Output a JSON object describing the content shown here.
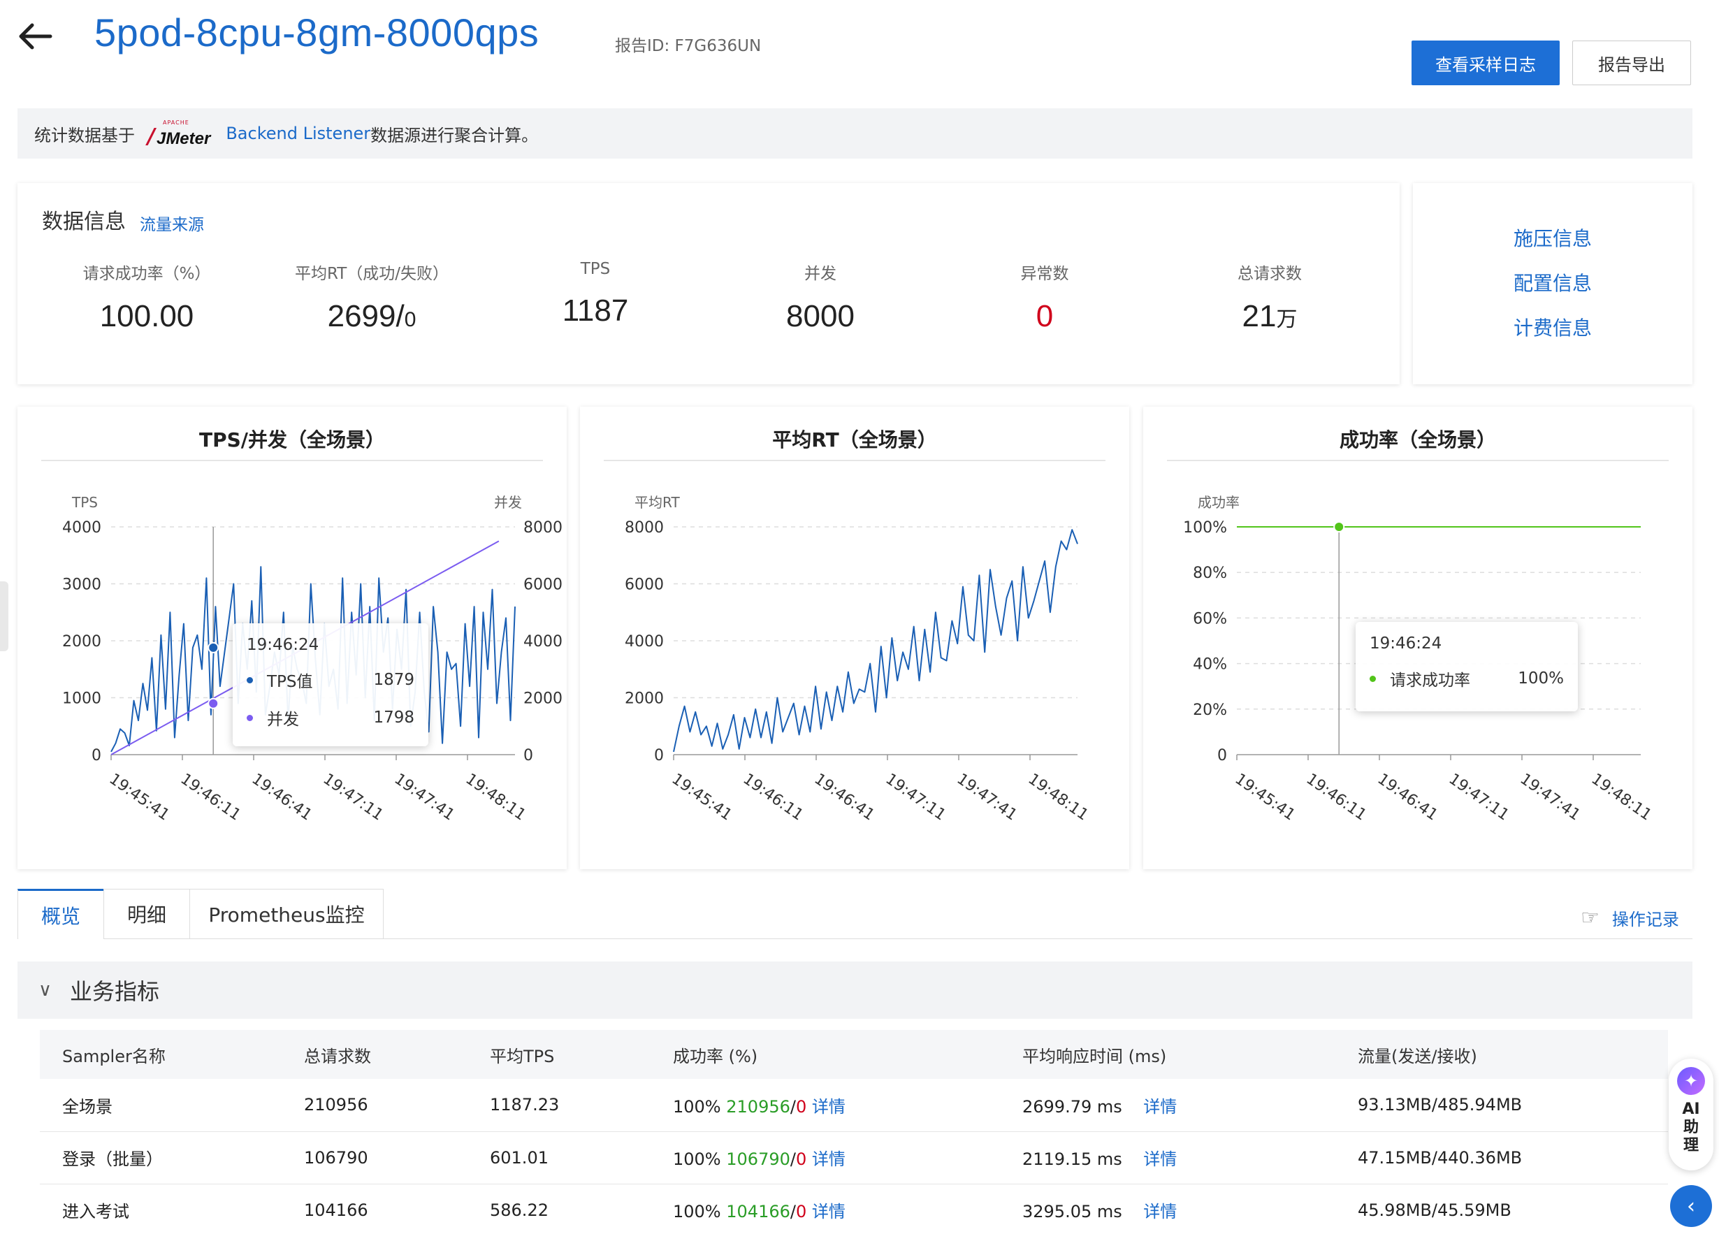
{
  "header": {
    "title": "5pod-8cpu-8gm-8000qps",
    "report_id": "报告ID:  F7G636UN",
    "view_log_label": "查看采样日志",
    "export_label": "报告导出"
  },
  "notice": {
    "prefix": "统计数据基于",
    "logo_text": "JMeter",
    "logo_small": "APACHE",
    "link": "Backend Listener",
    "suffix": "数据源进行聚合计算。"
  },
  "data_info": {
    "title": "数据信息",
    "source_link": "流量来源",
    "metrics": [
      {
        "label": "请求成功率（%）",
        "value": "100.00",
        "unit": ""
      },
      {
        "label": "平均RT（成功/失败）",
        "value": "2699/",
        "unit": "0"
      },
      {
        "label": "TPS",
        "value": "1187",
        "unit": ""
      },
      {
        "label": "并发",
        "value": "8000",
        "unit": ""
      },
      {
        "label": "异常数",
        "value": "0",
        "unit": ""
      },
      {
        "label": "总请求数",
        "value": "21",
        "unit": "万"
      }
    ]
  },
  "side_links": [
    "施压信息",
    "配置信息",
    "计费信息"
  ],
  "charts": {
    "x_ticks": [
      "19:45:41",
      "19:46:11",
      "19:46:41",
      "19:47:11",
      "19:47:41",
      "19:48:11"
    ],
    "tps": {
      "title": "TPS/并发（全场景）",
      "left_axis_name": "TPS",
      "right_axis_name": "并发",
      "left_ticks": [
        "0",
        "1000",
        "2000",
        "3000",
        "4000"
      ],
      "right_ticks": [
        "0",
        "2000",
        "4000",
        "6000",
        "8000"
      ],
      "tooltip": {
        "time": "19:46:24",
        "rows": [
          {
            "name": "TPS值",
            "value": "1879"
          },
          {
            "name": "并发",
            "value": "1798"
          }
        ]
      }
    },
    "rt": {
      "title": "平均RT（全场景）",
      "axis_name": "平均RT",
      "ticks": [
        "0",
        "2000",
        "4000",
        "6000",
        "8000"
      ]
    },
    "success": {
      "title": "成功率（全场景）",
      "axis_name": "成功率",
      "ticks": [
        "0",
        "20%",
        "40%",
        "60%",
        "80%",
        "100%"
      ],
      "tooltip": {
        "time": "19:46:24",
        "rows": [
          {
            "name": "请求成功率",
            "value": "100%"
          }
        ]
      }
    }
  },
  "chart_data": [
    {
      "type": "line",
      "title": "TPS/并发（全场景）",
      "x_range": [
        "19:45:41",
        "19:48:31"
      ],
      "series": [
        {
          "name": "TPS值",
          "axis": "left",
          "ylim": [
            0,
            4000
          ],
          "values": [
            50,
            200,
            450,
            380,
            160,
            950,
            600,
            1250,
            780,
            1700,
            420,
            2100,
            800,
            2500,
            300,
            1400,
            2300,
            600,
            1879,
            2100,
            1500,
            3100,
            700,
            2600,
            1200,
            1800,
            2400,
            3000,
            900,
            2300,
            1500,
            2700,
            1100,
            3300,
            700,
            1200,
            1800,
            1400,
            2500,
            600,
            1900,
            1500,
            1300,
            900,
            3000,
            1700,
            700,
            2300,
            1200,
            1500,
            800,
            3100,
            900,
            2500,
            1400,
            3000,
            1000,
            2600,
            600,
            3100,
            1800,
            2400,
            800,
            2200,
            1500,
            2900,
            500,
            1100,
            2500,
            1100,
            400,
            2600,
            1800,
            200,
            1800,
            1500,
            1600,
            500,
            2300,
            1200,
            2600,
            300,
            2500,
            1500,
            2900,
            900,
            1800,
            2400,
            600,
            2600
          ]
        },
        {
          "name": "并发",
          "axis": "right",
          "ylim": [
            0,
            8000
          ],
          "values": [
            0,
            7500
          ]
        }
      ]
    },
    {
      "type": "line",
      "title": "平均RT（全场景）",
      "x_range": [
        "19:45:41",
        "19:48:31"
      ],
      "ylim": [
        0,
        8000
      ],
      "series": [
        {
          "name": "平均RT",
          "values": [
            100,
            1000,
            1700,
            800,
            1500,
            700,
            1000,
            300,
            1100,
            200,
            700,
            1400,
            200,
            1300,
            600,
            1600,
            600,
            1500,
            400,
            2000,
            800,
            1300,
            1800,
            700,
            1700,
            800,
            2400,
            900,
            2200,
            1200,
            2400,
            1500,
            2900,
            1800,
            2300,
            2200,
            3200,
            1500,
            3800,
            2000,
            4100,
            2600,
            3600,
            3000,
            4500,
            2600,
            4400,
            2900,
            5000,
            3400,
            3300,
            4700,
            3900,
            5900,
            4200,
            4000,
            6300,
            3600,
            6500,
            5200,
            4200,
            5500,
            6100,
            4000,
            6600,
            4800,
            5400,
            6100,
            6800,
            5000,
            6600,
            7500,
            7200,
            7900,
            7400
          ]
        }
      ]
    },
    {
      "type": "line",
      "title": "成功率（全场景）",
      "x_range": [
        "19:45:41",
        "19:48:31"
      ],
      "ylim": [
        0,
        100
      ],
      "series": [
        {
          "name": "请求成功率",
          "values": [
            100,
            100
          ]
        }
      ]
    }
  ],
  "tabs": [
    "概览",
    "明细",
    "Prometheus监控"
  ],
  "oplog_label": "操作记录",
  "business": {
    "title": "业务指标",
    "columns": [
      "Sampler名称",
      "总请求数",
      "平均TPS",
      "成功率 (%)",
      "平均响应时间 (ms)",
      "流量(发送/接收)"
    ],
    "rows": [
      {
        "name": "全场景",
        "total": "210956",
        "tps": "1187.23",
        "rate": "100%",
        "ok": "210956",
        "sep": "/",
        "fail": "0",
        "detail": "详情",
        "rt": "2699.79 ms",
        "rt_detail": "详情",
        "traffic": "93.13MB/485.94MB"
      },
      {
        "name": "登录（批量）",
        "total": "106790",
        "tps": "601.01",
        "rate": "100%",
        "ok": "106790",
        "sep": "/",
        "fail": "0",
        "detail": "详情",
        "rt": "2119.15 ms",
        "rt_detail": "详情",
        "traffic": "47.15MB/440.36MB"
      },
      {
        "name": "进入考试",
        "total": "104166",
        "tps": "586.22",
        "rate": "100%",
        "ok": "104166",
        "sep": "/",
        "fail": "0",
        "detail": "详情",
        "rt": "3295.05 ms",
        "rt_detail": "详情",
        "traffic": "45.98MB/45.59MB"
      }
    ]
  },
  "ai_widget": {
    "label_1": "AI",
    "label_2": "助",
    "label_3": "理"
  },
  "colors": {
    "accent": "#1d6fd6",
    "link": "#1b6ac9",
    "line_blue": "#1a5fb4",
    "line_purple": "#7b5cf0",
    "line_green": "#52c41a",
    "error_red": "#d0021b",
    "ok_green": "#2a9d27"
  }
}
